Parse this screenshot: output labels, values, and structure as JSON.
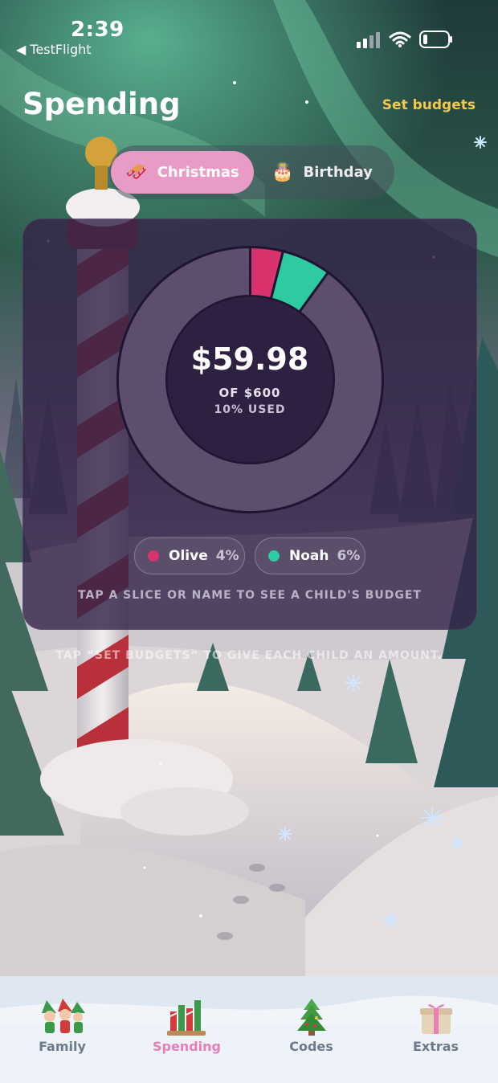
{
  "status_bar": {
    "time": "2:39",
    "back_label": "◀ TestFlight"
  },
  "header": {
    "title": "Spending",
    "set_budgets": "Set budgets"
  },
  "segments": [
    {
      "label": "Christmas",
      "icon": "sleigh-icon",
      "emoji": "🛷",
      "selected": true
    },
    {
      "label": "Birthday",
      "icon": "cake-icon",
      "emoji": "🎂",
      "selected": false
    }
  ],
  "summary": {
    "amount": "$59.98",
    "of_label": "OF $600",
    "used_label": "10% USED"
  },
  "chart_data": {
    "type": "pie",
    "title": "",
    "total_budget": 600,
    "spent": 59.98,
    "slices": [
      {
        "name": "Olive",
        "percent": 4,
        "color": "#d8336d"
      },
      {
        "name": "Noah",
        "percent": 6,
        "color": "#2ecaa2"
      }
    ],
    "remainder_color": "#5e4e6e"
  },
  "children": [
    {
      "name": "Olive",
      "percent_label": "4%",
      "color": "#d8336d"
    },
    {
      "name": "Noah",
      "percent_label": "6%",
      "color": "#2ecaa2"
    }
  ],
  "hints": {
    "card_hint": "TAP A SLICE OR NAME TO SEE A CHILD'S BUDGET",
    "footer_hint": "TAP “SET BUDGETS” TO GIVE EACH CHILD AN AMOUNT."
  },
  "tabs": [
    {
      "label": "Family",
      "icon": "elves-icon",
      "active": false
    },
    {
      "label": "Spending",
      "icon": "candy-gifts-icon",
      "active": true
    },
    {
      "label": "Codes",
      "icon": "christmas-tree-icon",
      "active": false
    },
    {
      "label": "Extras",
      "icon": "gift-box-icon",
      "active": false
    }
  ],
  "colors": {
    "accent_pink": "#e89bc4",
    "set_budgets": "#f4c84a",
    "olive": "#d8336d",
    "noah": "#2ecaa2"
  }
}
